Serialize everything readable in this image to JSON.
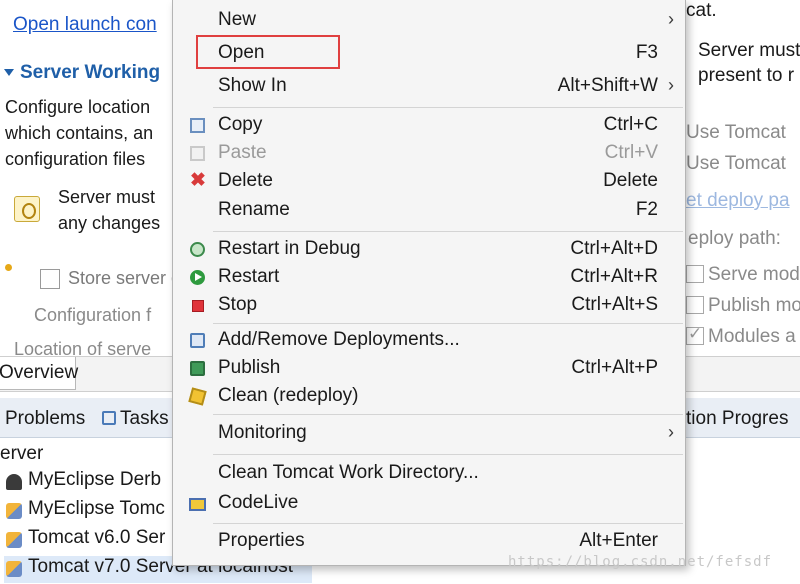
{
  "editor": {
    "launch_link": "Open launch con",
    "section_title": "Server Working",
    "description_lines": [
      "Configure location",
      "which contains, an",
      "configuration files"
    ],
    "server_must_lines": [
      "Server must",
      "any changes"
    ],
    "store_label": "Store server co",
    "config_label": "Configuration f",
    "location_label": "Location of serve",
    "overview_tab": "Overview"
  },
  "right_panel": {
    "cat_text": "cat.",
    "server_must_lines": [
      "Server must",
      "present to r"
    ],
    "use_tomcat_1": "Use Tomcat",
    "use_tomcat_2": "Use Tomcat",
    "deploy_link": "et deploy pa",
    "deploy_path": "eploy path:",
    "serve_mod": "Serve mod",
    "publish_mod": "Publish mo",
    "modules": "Modules a",
    "progress_tab": "tion  Progres"
  },
  "views": {
    "problems_label": "Problems",
    "tasks_label": "Tasks"
  },
  "servers": {
    "header": "erver",
    "rows": [
      {
        "label": "MyEclipse Derb",
        "icon": "derby-icon"
      },
      {
        "label": "MyEclipse Tomc",
        "icon": "tomcat-icon"
      },
      {
        "label": "Tomcat v6.0 Ser",
        "icon": "tomcat-icon"
      },
      {
        "label": "Tomcat v7.0 Server at localhost",
        "icon": "tomcat-icon",
        "selected": true
      }
    ]
  },
  "context_menu": {
    "items": [
      {
        "label": "New",
        "shortcut": "",
        "submenu": true
      },
      {
        "label": "Open",
        "shortcut": "F3",
        "highlight_box": true,
        "highlight_color": "#e04040"
      },
      {
        "label": "Show In",
        "shortcut": "Alt+Shift+W",
        "submenu": true
      },
      {
        "label": "Copy",
        "shortcut": "Ctrl+C",
        "icon": "copy-icon"
      },
      {
        "label": "Paste",
        "shortcut": "Ctrl+V",
        "icon": "paste-icon",
        "disabled": true
      },
      {
        "label": "Delete",
        "shortcut": "Delete",
        "icon": "delete-icon"
      },
      {
        "label": "Rename",
        "shortcut": "F2"
      },
      {
        "label": "Restart in Debug",
        "shortcut": "Ctrl+Alt+D",
        "icon": "debug-icon"
      },
      {
        "label": "Restart",
        "shortcut": "Ctrl+Alt+R",
        "icon": "restart-icon"
      },
      {
        "label": "Stop",
        "shortcut": "Ctrl+Alt+S",
        "icon": "stop-icon"
      },
      {
        "label": "Add/Remove Deployments...",
        "shortcut": "",
        "icon": "deployments-icon"
      },
      {
        "label": "Publish",
        "shortcut": "Ctrl+Alt+P",
        "icon": "publish-icon"
      },
      {
        "label": "Clean (redeploy)",
        "shortcut": "",
        "icon": "clean-icon"
      },
      {
        "label": "Monitoring",
        "shortcut": "",
        "submenu": true
      },
      {
        "label": "Clean Tomcat Work Directory...",
        "shortcut": ""
      },
      {
        "label": "CodeLive",
        "shortcut": "",
        "icon": "codelive-icon"
      },
      {
        "label": "Properties",
        "shortcut": "Alt+Enter"
      }
    ],
    "submenu_arrow": "›"
  },
  "watermark": "https://blog.csdn.net/fefsdf"
}
